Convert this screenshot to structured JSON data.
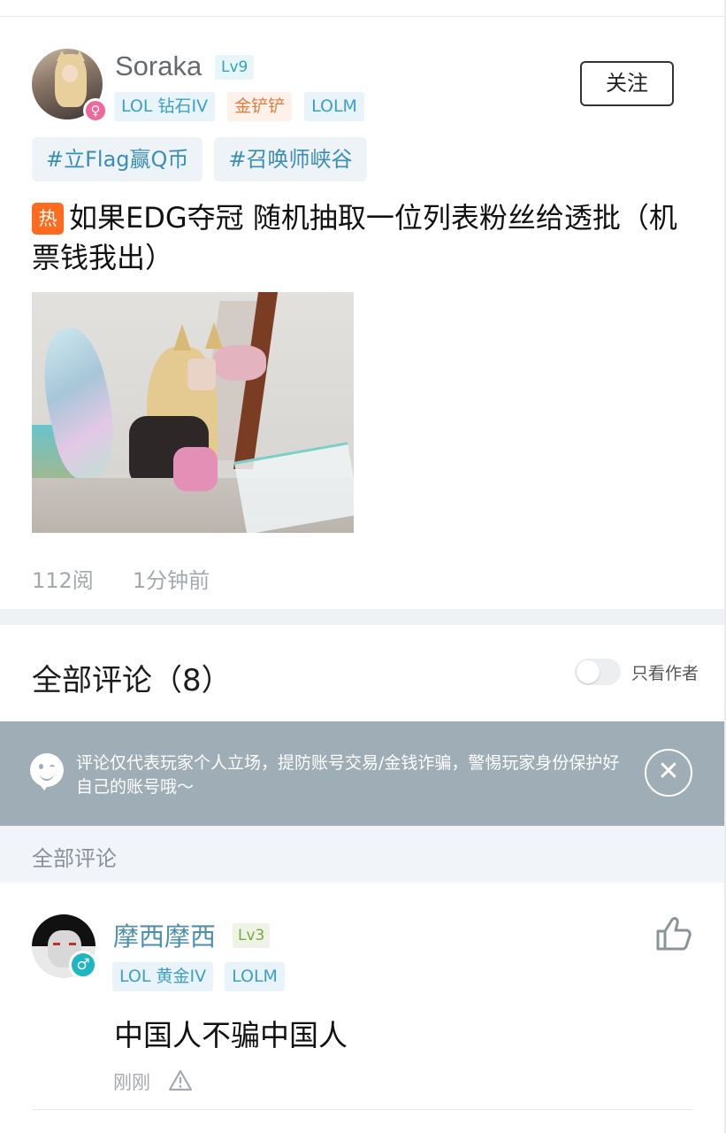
{
  "post": {
    "author": {
      "name": "Soraka",
      "level": "Lv9",
      "gender_symbol": "♀",
      "tags": [
        {
          "label": "LOL 钻石IV",
          "style": "blue"
        },
        {
          "label": "金铲铲",
          "style": "orange"
        },
        {
          "label": "LOLM",
          "style": "blue"
        }
      ]
    },
    "follow_label": "关注",
    "topics": [
      "#立Flag赢Q币",
      "#召唤师峡谷"
    ],
    "hot_badge": "热",
    "title": "如果EDG夺冠 随机抽取一位列表粉丝给透批（机票钱我出）",
    "views": "112阅",
    "time": "1分钟前"
  },
  "comments_section": {
    "title": "全部评论（8）",
    "author_only_label": "只看作者",
    "author_only_enabled": false,
    "notice": "评论仅代表玩家个人立场，提防账号交易/金钱诈骗，警惕玩家身份保护好自己的账号哦～",
    "close_symbol": "✕",
    "sub_header": "全部评论"
  },
  "comments": [
    {
      "name": "摩西摩西",
      "level": "Lv3",
      "gender_symbol": "♂",
      "tags": [
        "LOL 黄金IV",
        "LOLM"
      ],
      "text": "中国人不骗中国人",
      "time": "刚刚"
    }
  ],
  "colors": {
    "accent_blue": "#3d9fc4",
    "hot": "#ff6b1f",
    "notice_bg": "#9eadb6",
    "name_link": "#4f8fae"
  },
  "icons": [
    "female-icon",
    "male-icon",
    "hot-icon",
    "smile-chat-icon",
    "close-icon",
    "thumbs-up-icon",
    "warning-icon"
  ]
}
